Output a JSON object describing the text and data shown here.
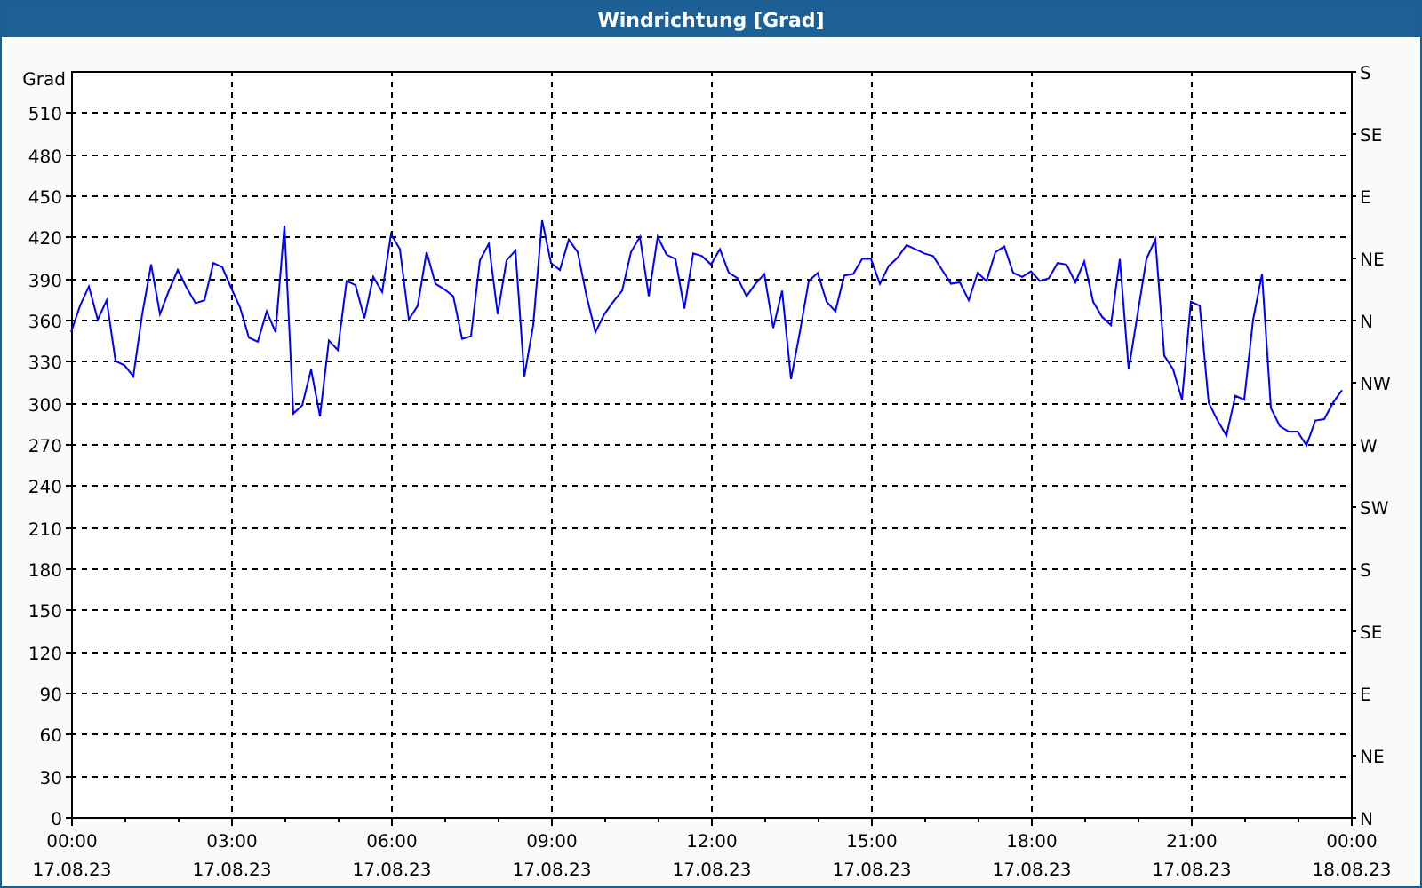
{
  "window": {
    "title": "Windrichtung [Grad]"
  },
  "chart_data": {
    "type": "line",
    "grid": true,
    "ylabel": "Grad",
    "ylim": [
      0,
      540
    ],
    "categories": [
      "00:00\n17.08.23",
      null,
      null,
      null,
      null,
      null,
      null,
      null,
      null,
      null,
      null,
      null,
      null,
      null,
      null,
      null,
      null,
      null,
      "03:00\n17.08.23",
      null,
      null,
      null,
      null,
      null,
      null,
      null,
      null,
      null,
      null,
      null,
      null,
      null,
      null,
      null,
      null,
      null,
      "06:00\n17.08.23",
      null,
      null,
      null,
      null,
      null,
      null,
      null,
      null,
      null,
      null,
      null,
      null,
      null,
      null,
      null,
      null,
      null,
      "09:00\n17.08.23",
      null,
      null,
      null,
      null,
      null,
      null,
      null,
      null,
      null,
      null,
      null,
      null,
      null,
      null,
      null,
      null,
      null,
      "12:00\n17.08.23",
      null,
      null,
      null,
      null,
      null,
      null,
      null,
      null,
      null,
      null,
      null,
      null,
      null,
      null,
      null,
      null,
      null,
      "15:00\n17.08.23",
      null,
      null,
      null,
      null,
      null,
      null,
      null,
      null,
      null,
      null,
      null,
      null,
      null,
      null,
      null,
      null,
      null,
      "18:00\n17.08.23",
      null,
      null,
      null,
      null,
      null,
      null,
      null,
      null,
      null,
      null,
      null,
      null,
      null,
      null,
      null,
      null,
      null,
      "21:00\n17.08.23",
      null,
      null,
      null,
      null,
      null,
      null,
      null,
      null,
      null,
      null,
      null,
      null,
      null,
      null,
      null,
      null,
      null,
      "00:00\n18.08.23"
    ],
    "series": [
      {
        "color": "#0000ff",
        "values": [
          351,
          370,
          384,
          360,
          374,
          330,
          327,
          319,
          364,
          400,
          364,
          381,
          396,
          383,
          372,
          374,
          401,
          398,
          383,
          369,
          347,
          344,
          366,
          351,
          428,
          292,
          298,
          324,
          290,
          345,
          338,
          388,
          385,
          361,
          391,
          380,
          422,
          411,
          360,
          370,
          409,
          386,
          382,
          377,
          346,
          348,
          403,
          415,
          364,
          403,
          410,
          319,
          356,
          432,
          401,
          396,
          418,
          409,
          377,
          351,
          364,
          373,
          381,
          409,
          420,
          377,
          420,
          407,
          404,
          368,
          408,
          406,
          400,
          411,
          394,
          390,
          377,
          386,
          393,
          354,
          381,
          317,
          351,
          388,
          394,
          373,
          366,
          392,
          393,
          404,
          404,
          386,
          399,
          405,
          414,
          411,
          408,
          406,
          396,
          386,
          387,
          374,
          394,
          388,
          409,
          413,
          394,
          391,
          395,
          388,
          390,
          401,
          400,
          387,
          402,
          373,
          362,
          356,
          404,
          324,
          364,
          404,
          418,
          334,
          324,
          302,
          373,
          370,
          300,
          287,
          276,
          305,
          302,
          360,
          393,
          296,
          283,
          279,
          279,
          269,
          287,
          288,
          300,
          309,
          null
        ]
      }
    ],
    "yticks": [
      0,
      30,
      60,
      90,
      120,
      150,
      180,
      210,
      240,
      270,
      300,
      330,
      360,
      390,
      420,
      450,
      480,
      510
    ]
  },
  "compass_axis": [
    "S",
    "SE",
    "E",
    "NE",
    "N",
    "NW",
    "W",
    "SW",
    "S",
    "SE",
    "E",
    "NE",
    "N"
  ]
}
